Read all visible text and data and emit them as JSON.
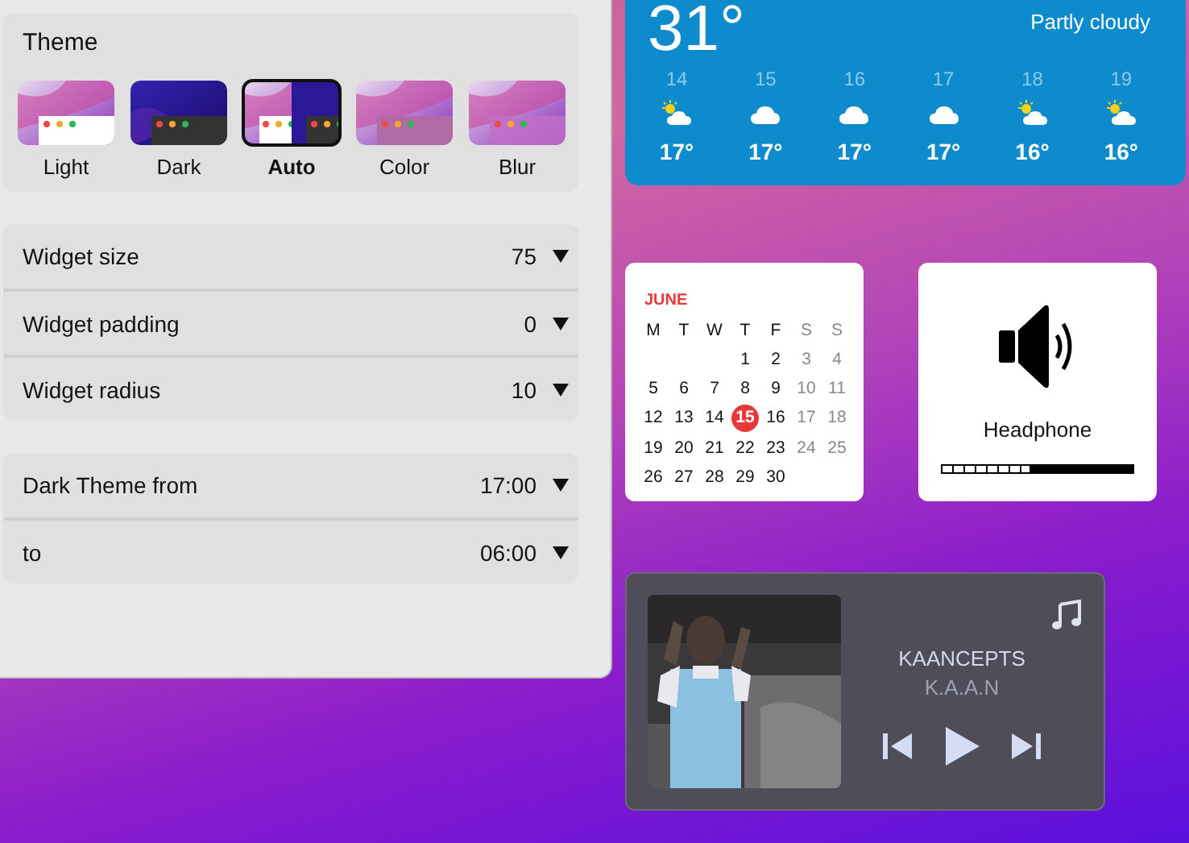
{
  "settings": {
    "theme": {
      "title": "Theme",
      "options": [
        {
          "label": "Light",
          "kind": "light",
          "selected": false
        },
        {
          "label": "Dark",
          "kind": "dark",
          "selected": false
        },
        {
          "label": "Auto",
          "kind": "auto",
          "selected": true
        },
        {
          "label": "Color",
          "kind": "color",
          "selected": false
        },
        {
          "label": "Blur",
          "kind": "blur",
          "selected": false
        }
      ]
    },
    "groups": [
      [
        {
          "label": "Widget size",
          "value": "75"
        },
        {
          "label": "Widget padding",
          "value": "0"
        },
        {
          "label": "Widget radius",
          "value": "10"
        }
      ],
      [
        {
          "label": "Dark Theme from",
          "value": "17:00"
        },
        {
          "label": "to",
          "value": "06:00"
        }
      ]
    ]
  },
  "weather": {
    "temperature": "31°",
    "condition": "Partly cloudy",
    "forecast": [
      {
        "hour": "14",
        "kind": "partly-sunny",
        "temp": "17°"
      },
      {
        "hour": "15",
        "kind": "cloudy",
        "temp": "17°"
      },
      {
        "hour": "16",
        "kind": "cloudy",
        "temp": "17°"
      },
      {
        "hour": "17",
        "kind": "cloudy",
        "temp": "17°"
      },
      {
        "hour": "18",
        "kind": "partly-sunny",
        "temp": "16°"
      },
      {
        "hour": "19",
        "kind": "partly-sunny",
        "temp": "16°"
      }
    ]
  },
  "calendar": {
    "month": "JUNE",
    "weekdays": [
      {
        "label": "M",
        "weekend": false
      },
      {
        "label": "T",
        "weekend": false
      },
      {
        "label": "W",
        "weekend": false
      },
      {
        "label": "T",
        "weekend": false
      },
      {
        "label": "F",
        "weekend": false
      },
      {
        "label": "S",
        "weekend": true
      },
      {
        "label": "S",
        "weekend": true
      }
    ],
    "weeks": [
      {
        "right_aligned": true,
        "days": [
          {
            "day": "1",
            "weekend": false,
            "selected": false
          },
          {
            "day": "2",
            "weekend": false,
            "selected": false
          },
          {
            "day": "3",
            "weekend": true,
            "selected": false
          },
          {
            "day": "4",
            "weekend": true,
            "selected": false
          }
        ]
      },
      {
        "right_aligned": false,
        "days": [
          {
            "day": "5",
            "weekend": false,
            "selected": false
          },
          {
            "day": "6",
            "weekend": false,
            "selected": false
          },
          {
            "day": "7",
            "weekend": false,
            "selected": false
          },
          {
            "day": "8",
            "weekend": false,
            "selected": false
          },
          {
            "day": "9",
            "weekend": false,
            "selected": false
          },
          {
            "day": "10",
            "weekend": true,
            "selected": false
          },
          {
            "day": "11",
            "weekend": true,
            "selected": false
          }
        ]
      },
      {
        "right_aligned": false,
        "days": [
          {
            "day": "12",
            "weekend": false,
            "selected": false
          },
          {
            "day": "13",
            "weekend": false,
            "selected": false
          },
          {
            "day": "14",
            "weekend": false,
            "selected": false
          },
          {
            "day": "15",
            "weekend": false,
            "selected": true
          },
          {
            "day": "16",
            "weekend": false,
            "selected": false
          },
          {
            "day": "17",
            "weekend": true,
            "selected": false
          },
          {
            "day": "18",
            "weekend": true,
            "selected": false
          }
        ]
      },
      {
        "right_aligned": false,
        "days": [
          {
            "day": "19",
            "weekend": false,
            "selected": false
          },
          {
            "day": "20",
            "weekend": false,
            "selected": false
          },
          {
            "day": "21",
            "weekend": false,
            "selected": false
          },
          {
            "day": "22",
            "weekend": false,
            "selected": false
          },
          {
            "day": "23",
            "weekend": false,
            "selected": false
          },
          {
            "day": "24",
            "weekend": true,
            "selected": false
          },
          {
            "day": "25",
            "weekend": true,
            "selected": false
          }
        ]
      },
      {
        "right_aligned": false,
        "days": [
          {
            "day": "26",
            "weekend": false,
            "selected": false
          },
          {
            "day": "27",
            "weekend": false,
            "selected": false
          },
          {
            "day": "28",
            "weekend": false,
            "selected": false
          },
          {
            "day": "29",
            "weekend": false,
            "selected": false
          },
          {
            "day": "30",
            "weekend": false,
            "selected": false
          }
        ]
      }
    ]
  },
  "volume": {
    "device": "Headphone",
    "level": 0.47
  },
  "music": {
    "title": "KAANCEPTS",
    "artist": "K.A.A.N"
  }
}
